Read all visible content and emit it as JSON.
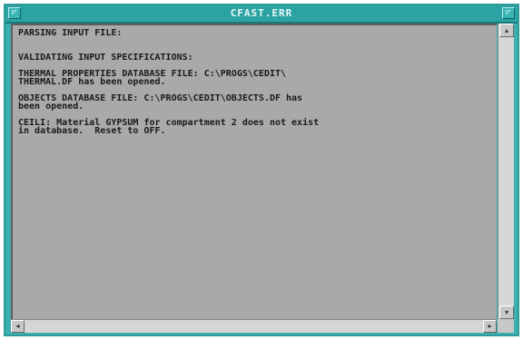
{
  "window": {
    "title": "CFAST.ERR"
  },
  "title_buttons": {
    "left_glyph": "◸",
    "right_glyph": "◸"
  },
  "console": {
    "lines": [
      "PARSING INPUT FILE:",
      "",
      "",
      "VALIDATING INPUT SPECIFICATIONS:",
      "",
      "THERMAL PROPERTIES DATABASE FILE: C:\\PROGS\\CEDIT\\",
      "THERMAL.DF has been opened.",
      "",
      "OBJECTS DATABASE FILE: C:\\PROGS\\CEDIT\\OBJECTS.DF has",
      "been opened.",
      "",
      "CEILI: Material GYPSUM for compartment 2 does not exist",
      "in database.  Reset to OFF."
    ]
  },
  "scrollbars": {
    "up_arrow": "▴",
    "down_arrow": "▾",
    "left_arrow": "◂",
    "right_arrow": "▸"
  },
  "colors": {
    "frame": "#3cb0b0",
    "titlebar": "#2ca3a3",
    "client_background": "#a9a9a9",
    "text": "#1a1a1a"
  }
}
